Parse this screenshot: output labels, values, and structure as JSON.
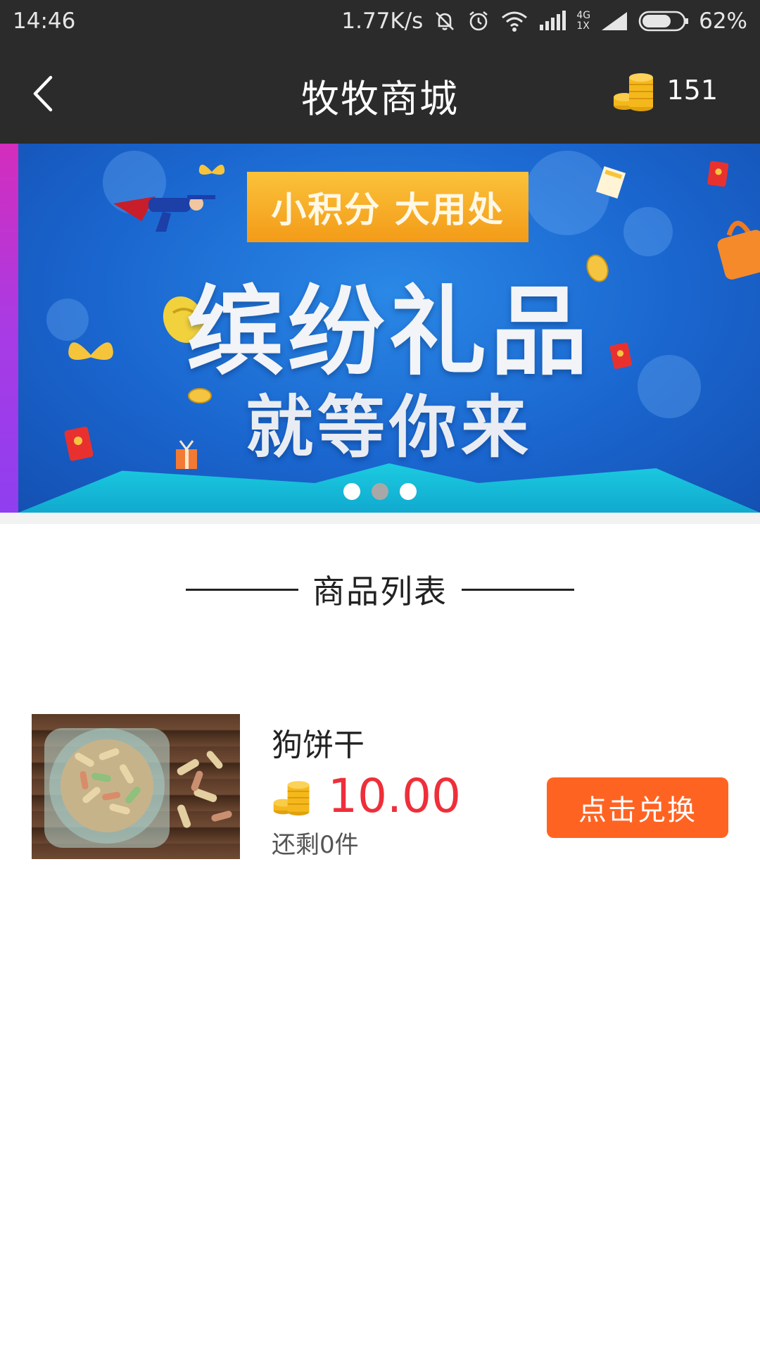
{
  "status_bar": {
    "time": "14:46",
    "net_speed": "1.77K/s",
    "net_type_top": "4G",
    "net_type_bottom": "1X",
    "battery": "62%"
  },
  "app_bar": {
    "title": "牧牧商城",
    "coin_balance": "151",
    "back_icon": "chevron-left-icon"
  },
  "banner": {
    "ribbon_text": "小积分 大用处",
    "headline": "缤纷礼品",
    "subline": "就等你来",
    "slide_count": 3,
    "active_slide": 2
  },
  "section": {
    "title": "商品列表"
  },
  "products": [
    {
      "name": "狗饼干",
      "price": "10.00",
      "stock": "还剩0件",
      "button_label": "点击兑换"
    }
  ],
  "colors": {
    "bar_bg": "#2b2b2b",
    "price": "#ee2f3a",
    "button": "#ff6322",
    "coin": "#f5b81c"
  }
}
